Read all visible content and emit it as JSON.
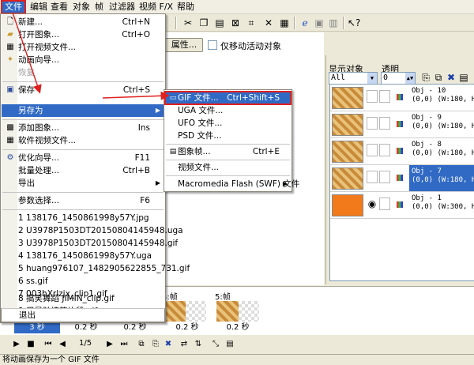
{
  "menubar": {
    "items": [
      {
        "label": "文件",
        "active": true
      },
      {
        "label": "编辑"
      },
      {
        "label": "查看"
      },
      {
        "label": "对象"
      },
      {
        "label": "帧"
      },
      {
        "label": "过滤器"
      },
      {
        "label": "视频 F/X"
      },
      {
        "label": "帮助"
      }
    ]
  },
  "toolbar": {
    "icons": [
      "cut-icon",
      "copy-icon",
      "paste-icon",
      "delete-icon",
      "crop-icon",
      "select-icon",
      "ie-icon",
      "grid-icon",
      "image-icon",
      "layout-icon",
      "help-pointer-icon"
    ]
  },
  "properties_bar": {
    "properties_button": "属性...",
    "move_active_label": "仅移动活动对象"
  },
  "object_panel": {
    "show_objects_label": "显示对象",
    "transparency_label": "透明",
    "show_select_value": "All Object:",
    "transparency_value": "0",
    "objects": [
      {
        "name": "Obj - 10",
        "info": "(0,0) (W:180, H:1",
        "selected": false
      },
      {
        "name": "Obj - 9",
        "info": "(0,0) (W:180, H:1",
        "selected": false
      },
      {
        "name": "Obj - 8",
        "info": "(0,0) (W:180, H:1",
        "selected": false
      },
      {
        "name": "Obj - 7",
        "info": "(0,0) (W:180, H:1",
        "selected": true
      },
      {
        "name": "Obj - 1",
        "info": "(0,0) (W:300, H:1",
        "selected": false
      }
    ]
  },
  "frames": {
    "labels": [
      "4:帧",
      "5:帧"
    ],
    "times": [
      "3 秒",
      "0.2 秒",
      "0.2 秒",
      "0.2 秒",
      "0.2 秒"
    ],
    "counter": "1/5"
  },
  "statusbar": {
    "text": "将动画保存为一个 GIF 文件"
  },
  "file_menu": {
    "items": [
      {
        "icon": "new-icon",
        "label": "新建...",
        "key": "Ctrl+N"
      },
      {
        "icon": "open-icon",
        "label": "打开图象...",
        "key": "Ctrl+O"
      },
      {
        "icon": "open-video-icon",
        "label": "打开视频文件..."
      },
      {
        "icon": "wizard-icon",
        "label": "动画向导..."
      },
      {
        "label": "恢复",
        "gray": true
      },
      {
        "sep": true
      },
      {
        "icon": "save-icon",
        "label": "保存",
        "key": "Ctrl+S"
      },
      {
        "label": "另存为",
        "submenu": true,
        "highlight": true
      },
      {
        "sep": true
      },
      {
        "icon": "add-image-icon",
        "label": "添加图象...",
        "key": "Ins"
      },
      {
        "icon": "video-file-icon",
        "label": "软件视频文件..."
      },
      {
        "sep": true
      },
      {
        "icon": "optimize-icon",
        "label": "优化向导...",
        "key": "F11"
      },
      {
        "label": "批量处理...",
        "key": "Ctrl+B"
      },
      {
        "label": "导出",
        "submenu": true
      },
      {
        "sep": true
      },
      {
        "label": "参数选择...",
        "key": "F6"
      },
      {
        "sep": true
      },
      {
        "label": "1 138176_1450861998y57Y.jpg"
      },
      {
        "label": "2 U3978P1503DT20150804145948.uga"
      },
      {
        "label": "3 U3978P1503DT20150804145948.gif"
      },
      {
        "label": "4 138176_1450861998y57Y.uga"
      },
      {
        "label": "5 huang976107_1482905622855_731.gif"
      },
      {
        "label": "6 ss.gif"
      },
      {
        "label": "7 003hXrlzjx_clip1.gif"
      },
      {
        "label": "8 搞笑舞蹈 JIMIN_clip.gif"
      },
      {
        "label": "9 周星驰搞笑片段.gif"
      },
      {
        "sep": true
      },
      {
        "label": "退出"
      }
    ]
  },
  "save_as_menu": {
    "items": [
      {
        "icon": "gif-icon",
        "label": "GIF 文件...",
        "key": "Ctrl+Shift+S",
        "highlight": true
      },
      {
        "label": "UGA 文件..."
      },
      {
        "label": "UFO 文件..."
      },
      {
        "label": "PSD 文件..."
      },
      {
        "sep": true
      },
      {
        "icon": "image-frame-icon",
        "label": "图象帧...",
        "key": "Ctrl+E"
      },
      {
        "sep": true
      },
      {
        "label": "视频文件..."
      },
      {
        "sep": true
      },
      {
        "label": "Macromedia Flash (SWF) 文件",
        "submenu": true
      }
    ]
  },
  "colors": {
    "highlight": "#316ac5",
    "annotation": "#e0201e",
    "chrome": "#ece9d8"
  }
}
